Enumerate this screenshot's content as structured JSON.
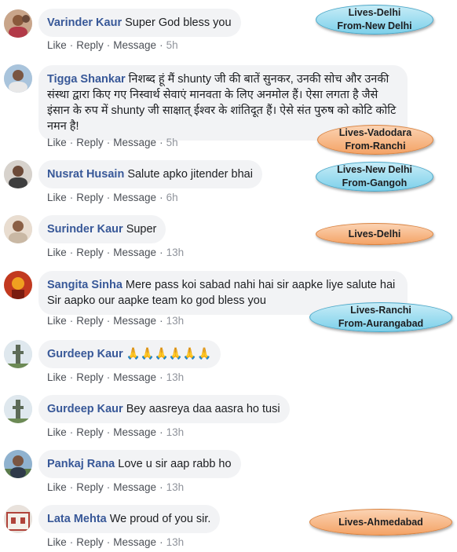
{
  "actions": {
    "like": "Like",
    "reply": "Reply",
    "message": "Message"
  },
  "comments": [
    {
      "name": "Varinder Kaur",
      "text": "Super God bless you",
      "time": "5h",
      "avatar": "avatar-woman"
    },
    {
      "name": "Tigga Shankar",
      "text": "निशब्द हूं मैं shunty जी की बातें सुनकर, उनकी सोच और उनकी संस्था द्वारा किए गए निस्वार्थ सेवाएं मानवता के लिए अनमोल हैं। ऐसा लगता है जैसे इंसान के रुप में shunty जी साक्षात् ईश्वर के शांतिदूत हैं। ऐसे संत पुरुष को कोटि कोटि नमन है!",
      "time": "5h",
      "avatar": "avatar-man"
    },
    {
      "name": "Nusrat Husain",
      "text": "Salute apko jitender bhai",
      "time": "6h",
      "avatar": "avatar-man"
    },
    {
      "name": "Surinder Kaur",
      "text": "Super",
      "time": "13h",
      "avatar": "avatar-woman"
    },
    {
      "name": "Sangita Sinha",
      "text": "Mere pass koi sabad nahi hai sir aapke liye salute hai Sir aapko our aapke team ko god bless you",
      "time": "13h",
      "avatar": "avatar-deity"
    },
    {
      "name": "Gurdeep Kaur",
      "text": "🙏🙏🙏🙏🙏🙏",
      "time": "13h",
      "avatar": "avatar-tower"
    },
    {
      "name": "Gurdeep Kaur",
      "text": "Bey aasreya daa aasra ho tusi",
      "time": "13h",
      "avatar": "avatar-tower"
    },
    {
      "name": "Pankaj Rana",
      "text": "Love u sir aap rabb ho",
      "time": "13h",
      "avatar": "avatar-man"
    },
    {
      "name": "Lata Mehta",
      "text": "We proud of you sir.",
      "time": "13h",
      "avatar": "avatar-building"
    }
  ],
  "tags": [
    {
      "line1": "Lives-Delhi",
      "line2": "From-New Delhi",
      "color": "#7dd0ea"
    },
    {
      "line1": "Lives-Vadodara",
      "line2": "From-Ranchi",
      "color": "#f4a366"
    },
    {
      "line1": "Lives-New Delhi",
      "line2": "From-Gangoh",
      "color": "#7dd0ea"
    },
    {
      "line1": "Lives-Delhi",
      "line2": "",
      "color": "#f4a366"
    },
    {
      "line1": "Lives-Ranchi",
      "line2": "From-Aurangabad",
      "color": "#7dd0ea"
    },
    {
      "line1": "Lives-Ahmedabad",
      "line2": "",
      "color": "#f4a366"
    }
  ]
}
